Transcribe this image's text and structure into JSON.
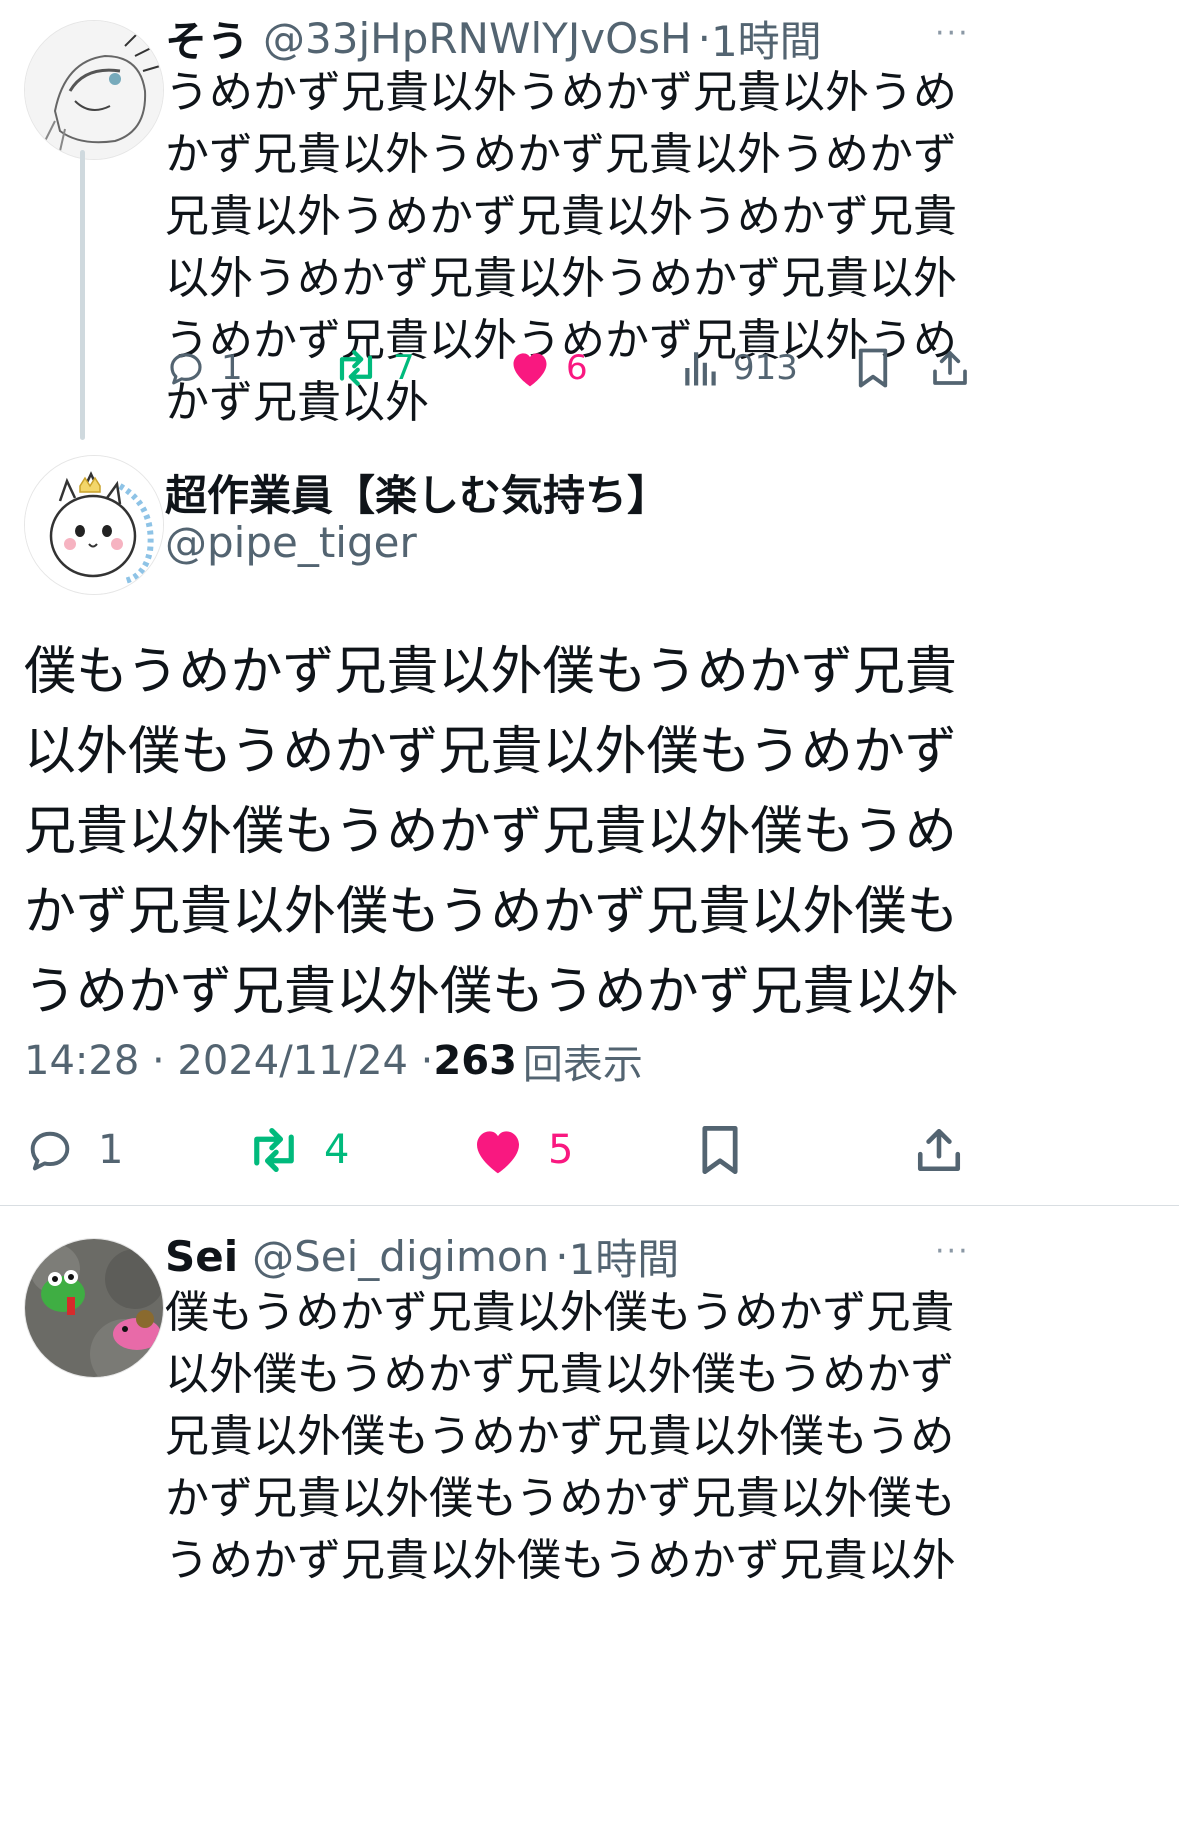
{
  "post1": {
    "name": "そう",
    "handle": "@33jHpRNWlYJvOsH",
    "separator": "·",
    "time": "1時間",
    "more": "···",
    "text": "うめかず兄貴以外うめかず兄貴以外うめかず兄貴以外うめかず兄貴以外うめかず兄貴以外うめかず兄貴以外うめかず兄貴以外うめかず兄貴以外うめかず兄貴以外うめかず兄貴以外うめかず兄貴以外うめかず兄貴以外",
    "reply_count": "1",
    "retweet_count": "7",
    "like_count": "6",
    "views_count": "913"
  },
  "main_post": {
    "name": "超作業員【楽しむ気持ち】",
    "handle": "@pipe_tiger",
    "text": "僕もうめかず兄貴以外僕もうめかず兄貴以外僕もうめかず兄貴以外僕もうめかず兄貴以外僕もうめかず兄貴以外僕もうめかず兄貴以外僕もうめかず兄貴以外僕もうめかず兄貴以外僕もうめかず兄貴以外",
    "timestamp": "14:28 · 2024/11/24 · ",
    "views": "263",
    "views_label": "回表示",
    "reply_count": "1",
    "retweet_count": "4",
    "like_count": "5"
  },
  "post3": {
    "name": "Sei",
    "handle": "@Sei_digimon",
    "separator": "·",
    "time": "1時間",
    "more": "···",
    "text": "僕もうめかず兄貴以外僕もうめかず兄貴以外僕もうめかず兄貴以外僕もうめかず兄貴以外僕もうめかず兄貴以外僕もうめかず兄貴以外僕もうめかず兄貴以外僕もうめかず兄貴以外僕もうめかず兄貴以外"
  },
  "colors": {
    "retweet": "#00ba7c",
    "like": "#f91880",
    "secondary_text": "#536471"
  }
}
